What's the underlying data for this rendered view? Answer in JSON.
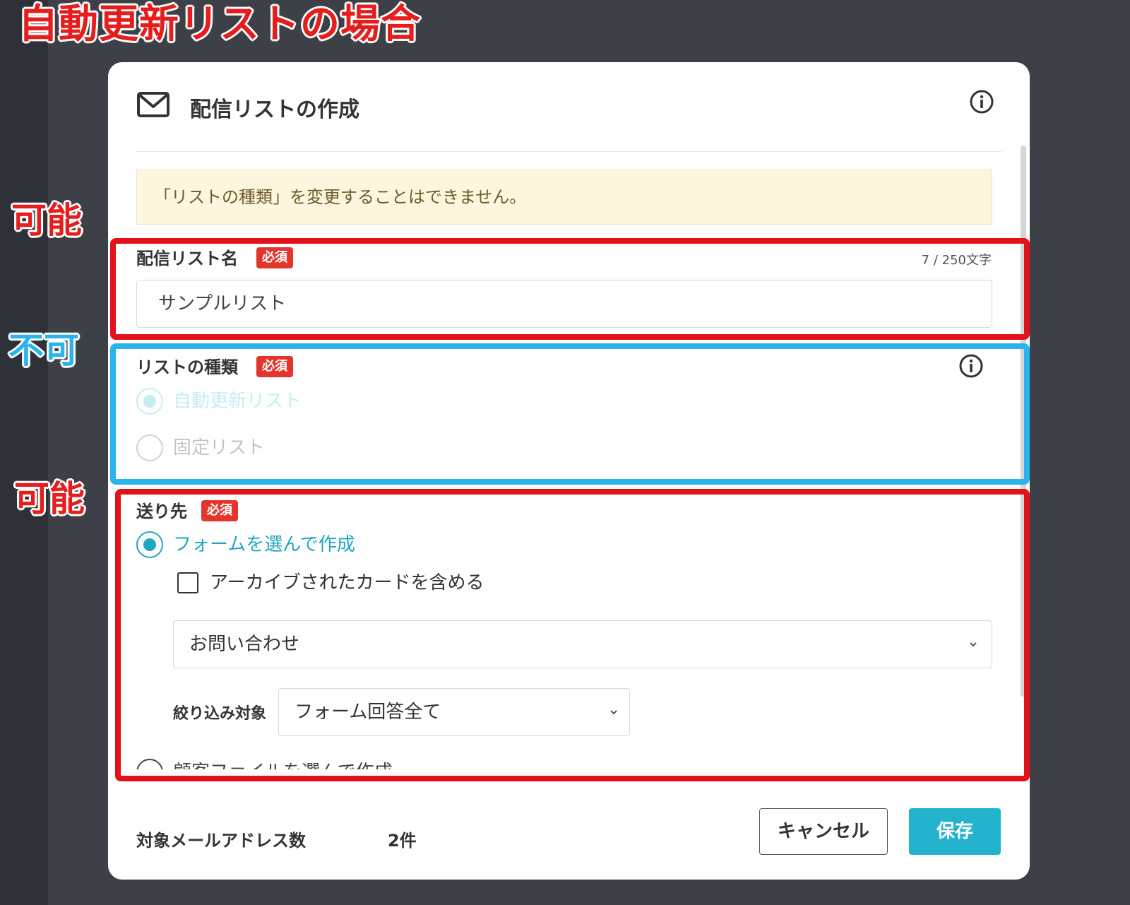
{
  "annotations": {
    "title": "自動更新リストの場合",
    "label_1": "可能",
    "label_2": "不可",
    "label_3": "可能"
  },
  "modal": {
    "title": "配信リストの作成",
    "notice": "「リストの種類」を変更することはできません。",
    "list_name": {
      "label": "配信リスト名",
      "required": "必須",
      "counter": "7 / 250文字",
      "value": "サンプルリスト"
    },
    "list_type": {
      "label": "リストの種類",
      "required": "必須",
      "options": [
        "自動更新リスト",
        "固定リスト"
      ],
      "selected": "自動更新リスト",
      "disabled": true
    },
    "destination": {
      "label": "送り先",
      "required": "必須",
      "option_form": "フォームを選んで作成",
      "include_archived": "アーカイブされたカードを含める",
      "include_archived_checked": false,
      "form_select": "お問い合わせ",
      "filter_label": "絞り込み対象",
      "filter_select": "フォーム回答全て",
      "option_customer_partial": "顧客ファイルを選んで作成"
    },
    "footer": {
      "count_label": "対象メールアドレス数",
      "count_value": "2件",
      "cancel": "キャンセル",
      "save": "保存"
    }
  },
  "colors": {
    "accent": "#24b3cc",
    "required_badge": "#e3352b",
    "annotation_red": "#e3111a",
    "annotation_blue": "#2bb3ee",
    "notice_bg": "#fdf6df"
  },
  "icons": [
    "mail-icon",
    "info-icon",
    "chevron-down-icon"
  ]
}
